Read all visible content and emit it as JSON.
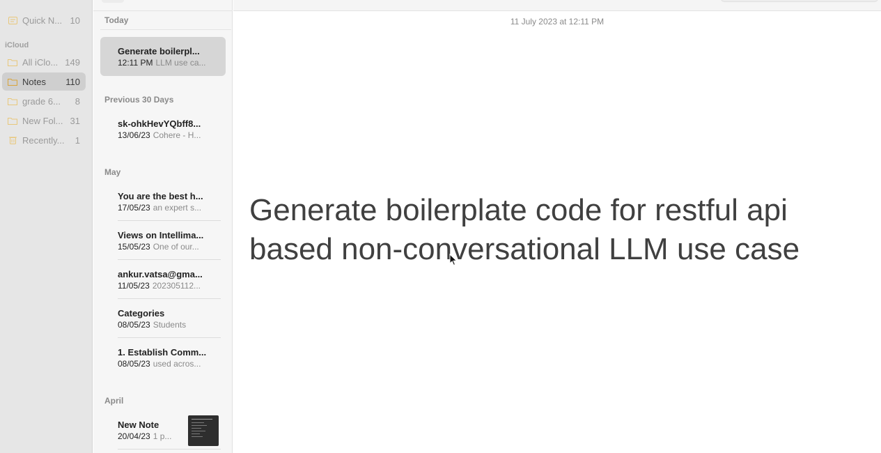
{
  "sidebar": {
    "top_items": [
      {
        "label": "Quick N...",
        "count": "10",
        "icon": "quick-notes-icon"
      }
    ],
    "section_label": "iCloud",
    "items": [
      {
        "label": "All iClo...",
        "count": "149",
        "icon": "folder-icon"
      },
      {
        "label": "Notes",
        "count": "110",
        "icon": "folder-icon"
      },
      {
        "label": "grade 6...",
        "count": "8",
        "icon": "folder-icon"
      },
      {
        "label": "New Fol...",
        "count": "31",
        "icon": "folder-icon"
      },
      {
        "label": "Recently...",
        "count": "1",
        "icon": "trash-icon"
      }
    ]
  },
  "notelist": {
    "sections": [
      {
        "label": "Today",
        "notes": [
          {
            "title": "Generate boilerpl...",
            "date": "12:11 PM",
            "snippet": "LLM use ca...",
            "selected": true
          }
        ]
      },
      {
        "label": "Previous 30 Days",
        "notes": [
          {
            "title": "sk-ohkHevYQbff8...",
            "date": "13/06/23",
            "snippet": "Cohere - H..."
          }
        ]
      },
      {
        "label": "May",
        "notes": [
          {
            "title": "You are the best h...",
            "date": "17/05/23",
            "snippet": "an expert s..."
          },
          {
            "title": "Views on Intellima...",
            "date": "15/05/23",
            "snippet": "One of our..."
          },
          {
            "title": "ankur.vatsa@gma...",
            "date": "11/05/23",
            "snippet": "202305112..."
          },
          {
            "title": "Categories",
            "date": "08/05/23",
            "snippet": "Students"
          },
          {
            "title": "1. Establish Comm...",
            "date": "08/05/23",
            "snippet": "used acros..."
          }
        ]
      },
      {
        "label": "April",
        "notes": [
          {
            "title": "New Note",
            "date": "20/04/23",
            "snippet": "1 p...",
            "thumbnail": true
          }
        ]
      }
    ]
  },
  "editor": {
    "date": "11 July 2023 at 12:11 PM",
    "body_line1": "Generate boilerplate code for restful api",
    "body_line2": "based non-conversational LLM use case"
  },
  "colors": {
    "folder_icon": "#e8b84a",
    "sidebar_bg": "#e6e6e6",
    "selected_bg": "#d6d6d6"
  }
}
